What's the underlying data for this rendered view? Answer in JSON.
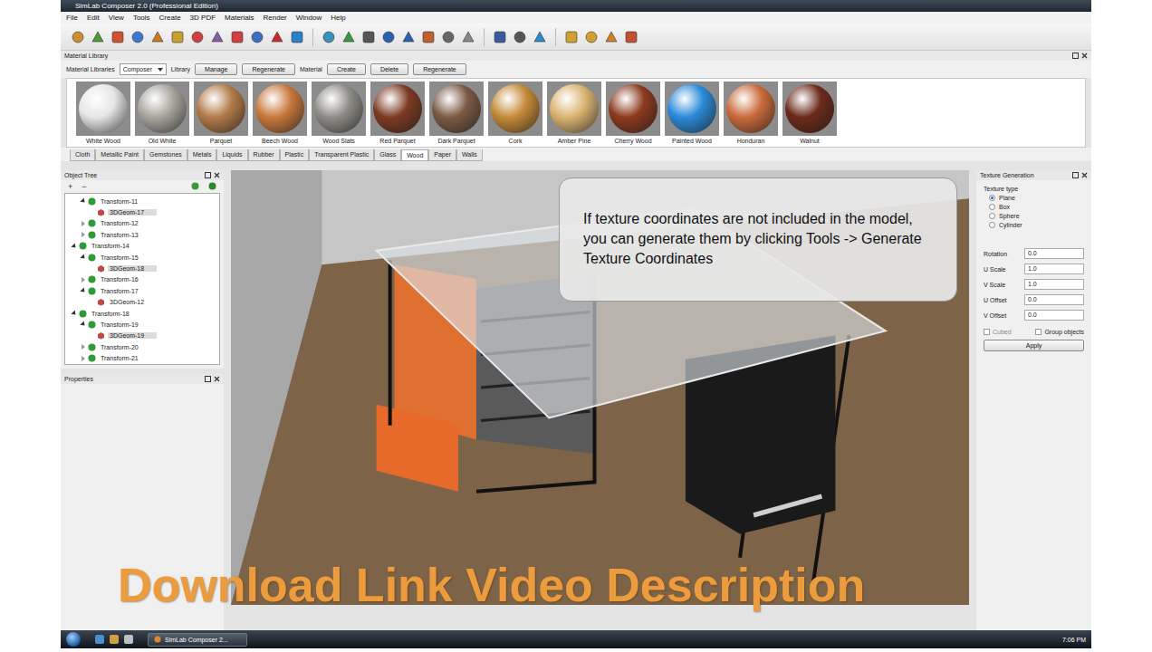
{
  "window": {
    "title": "SimLab Composer 2.0  (Professional Edition)"
  },
  "menu": [
    "File",
    "Edit",
    "View",
    "Tools",
    "Create",
    "3D PDF",
    "Materials",
    "Render",
    "Window",
    "Help"
  ],
  "material_library": {
    "title": "Material Library",
    "libraries_label": "Material Libraries",
    "libraries_value": "Composer",
    "library_label": "Library",
    "library_buttons": [
      "Manage",
      "Regenerate"
    ],
    "material_label": "Material",
    "material_buttons": [
      "Create",
      "Delete",
      "Regenerate"
    ]
  },
  "swatches": [
    {
      "name": "White Wood",
      "color": "#e6e6e6"
    },
    {
      "name": "Old White",
      "color": "#a8a59c"
    },
    {
      "name": "Parquet",
      "color": "#b27a48"
    },
    {
      "name": "Beech Wood",
      "color": "#c8783c"
    },
    {
      "name": "Wood Slats",
      "color": "#8e8c86"
    },
    {
      "name": "Red Parquet",
      "color": "#7c3a22"
    },
    {
      "name": "Dark Parquet",
      "color": "#7a5a44"
    },
    {
      "name": "Cork",
      "color": "#c48a38"
    },
    {
      "name": "Amber Pine",
      "color": "#dab470"
    },
    {
      "name": "Cherry Wood",
      "color": "#8c3a1e"
    },
    {
      "name": "Painted Wood",
      "color": "#2a8ad8"
    },
    {
      "name": "Honduran",
      "color": "#ca6a3a"
    },
    {
      "name": "Walnut",
      "color": "#6c2a1a"
    }
  ],
  "categories": [
    {
      "label": "Cloth",
      "selected": false
    },
    {
      "label": "Metallic Paint",
      "selected": false
    },
    {
      "label": "Gemstones",
      "selected": false
    },
    {
      "label": "Metals",
      "selected": false
    },
    {
      "label": "Liquids",
      "selected": false
    },
    {
      "label": "Rubber",
      "selected": false
    },
    {
      "label": "Plastic",
      "selected": false
    },
    {
      "label": "Transparent Plastic",
      "selected": false
    },
    {
      "label": "Glass",
      "selected": false
    },
    {
      "label": "Wood",
      "selected": true
    },
    {
      "label": "Paper",
      "selected": false
    },
    {
      "label": "Walls",
      "selected": false
    }
  ],
  "object_tree": {
    "title": "Object Tree",
    "tools": [
      "+",
      "−"
    ],
    "items": [
      {
        "label": "Transform-11",
        "kind": "transform",
        "depth": 2,
        "expanded": true,
        "selected": false
      },
      {
        "label": "3DGeom-17",
        "kind": "geom",
        "depth": 3,
        "expanded": false,
        "selected": true
      },
      {
        "label": "Transform-12",
        "kind": "transform",
        "depth": 2,
        "expanded": false,
        "selected": false
      },
      {
        "label": "Transform-13",
        "kind": "transform",
        "depth": 2,
        "expanded": false,
        "selected": false
      },
      {
        "label": "Transform-14",
        "kind": "transform",
        "depth": 1,
        "expanded": true,
        "selected": false
      },
      {
        "label": "Transform-15",
        "kind": "transform",
        "depth": 2,
        "expanded": true,
        "selected": false
      },
      {
        "label": "3DGeom-18",
        "kind": "geom",
        "depth": 3,
        "expanded": false,
        "selected": true
      },
      {
        "label": "Transform-16",
        "kind": "transform",
        "depth": 2,
        "expanded": false,
        "selected": false
      },
      {
        "label": "Transform-17",
        "kind": "transform",
        "depth": 2,
        "expanded": true,
        "selected": false
      },
      {
        "label": "3DGeom-12",
        "kind": "geom",
        "depth": 3,
        "expanded": false,
        "selected": false
      },
      {
        "label": "Transform-18",
        "kind": "transform",
        "depth": 1,
        "expanded": true,
        "selected": false
      },
      {
        "label": "Transform-19",
        "kind": "transform",
        "depth": 2,
        "expanded": true,
        "selected": false
      },
      {
        "label": "3DGeom-19",
        "kind": "geom",
        "depth": 3,
        "expanded": false,
        "selected": true
      },
      {
        "label": "Transform-20",
        "kind": "transform",
        "depth": 2,
        "expanded": false,
        "selected": false
      },
      {
        "label": "Transform-21",
        "kind": "transform",
        "depth": 2,
        "expanded": false,
        "selected": false
      }
    ]
  },
  "properties": {
    "title": "Properties"
  },
  "texture_generation": {
    "title": "Texture Generation",
    "type_label": "Texture type",
    "types": [
      {
        "label": "Plane",
        "selected": true
      },
      {
        "label": "Box",
        "selected": false
      },
      {
        "label": "Sphere",
        "selected": false
      },
      {
        "label": "Cylinder",
        "selected": false
      }
    ],
    "fields": [
      {
        "label": "Rotation",
        "value": "0.0"
      },
      {
        "label": "U Scale",
        "value": "1.0"
      },
      {
        "label": "V Scale",
        "value": "1.0"
      },
      {
        "label": "U Offset",
        "value": "0.0"
      },
      {
        "label": "V Offset",
        "value": "0.0"
      }
    ],
    "checkboxes": [
      {
        "label": "Cubed",
        "checked": false,
        "disabled": true
      },
      {
        "label": "Group objects",
        "checked": false,
        "disabled": false
      }
    ],
    "apply": "Apply"
  },
  "tip": "If texture coordinates are not included in the model, you can generate them by clicking Tools -> Generate Texture Coordinates",
  "banner": "Download Link Video Description",
  "taskbar": {
    "task": "SimLab Composer 2...",
    "time": "7:06 PM"
  }
}
